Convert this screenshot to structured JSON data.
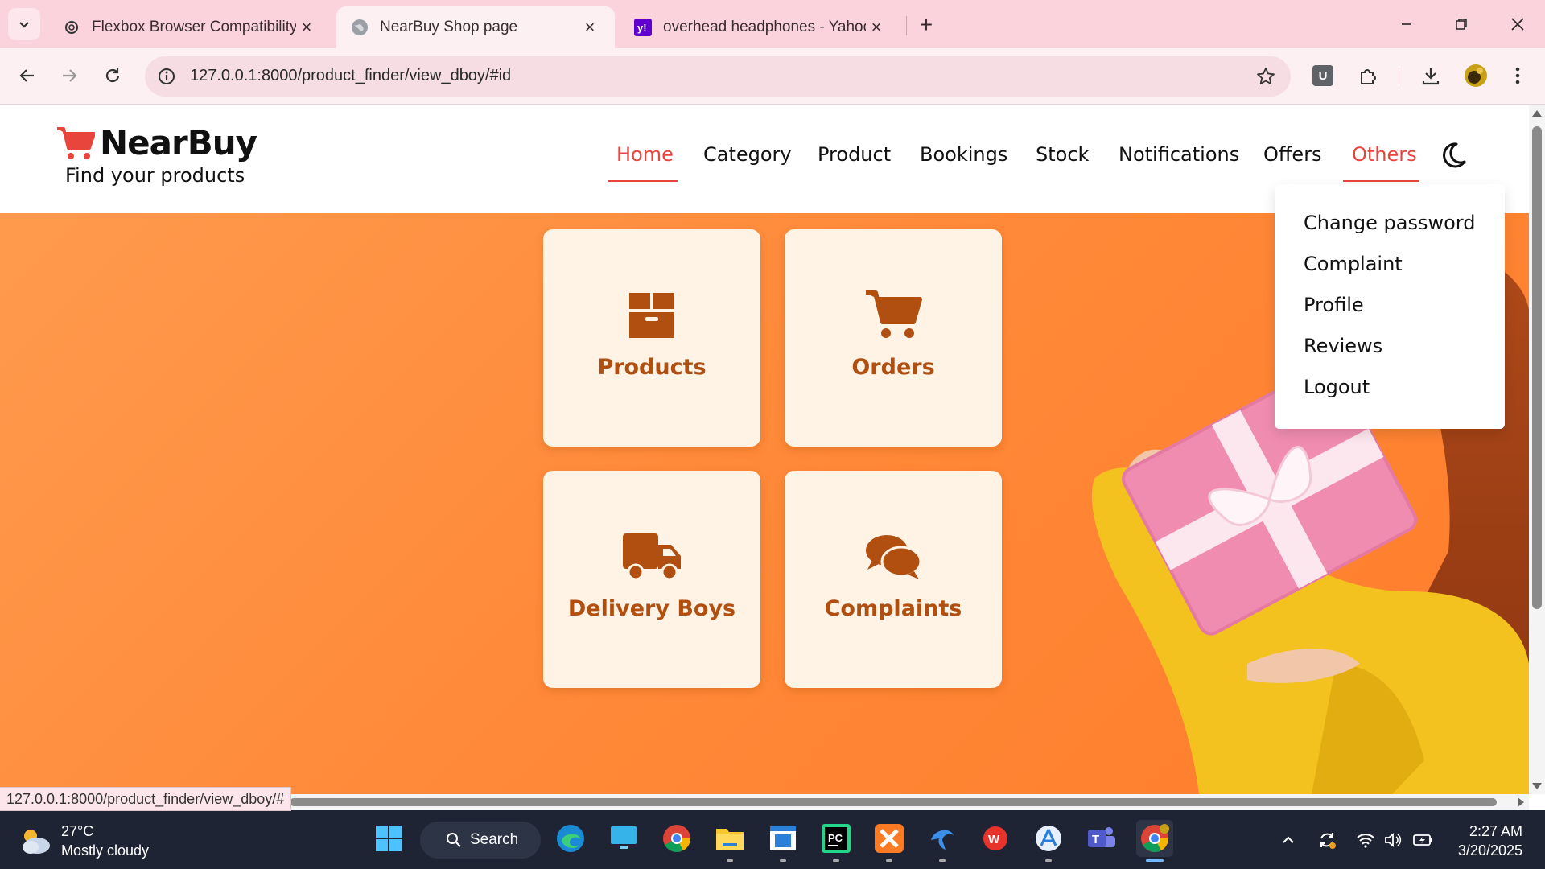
{
  "browser": {
    "tabs": [
      {
        "title": "Flexbox Browser Compatibility",
        "icon": "openai-icon",
        "active": false
      },
      {
        "title": "NearBuy Shop page",
        "icon": "globe-icon",
        "active": true
      },
      {
        "title": "overhead headphones - Yahoo",
        "icon": "yahoo-icon",
        "active": false
      }
    ],
    "url": "127.0.0.1:8000/product_finder/view_dboy/#id",
    "status_url": "127.0.0.1:8000/product_finder/view_dboy/#",
    "extension_badge": "U"
  },
  "site": {
    "brand_name": "NearBuy",
    "tagline": "Find your products",
    "nav": [
      "Home",
      "Category",
      "Product",
      "Bookings",
      "Stock",
      "Notifications",
      "Offers",
      "Others"
    ],
    "dropdown": [
      "Change password",
      "Complaint",
      "Profile",
      "Reviews",
      "Logout"
    ],
    "cards": [
      {
        "label": "Products",
        "icon": "box-icon"
      },
      {
        "label": "Orders",
        "icon": "cart-icon"
      },
      {
        "label": "Delivery Boys",
        "icon": "truck-icon"
      },
      {
        "label": "Complaints",
        "icon": "comments-icon"
      }
    ],
    "colors": {
      "accent": "#e8453c",
      "card_text": "#b14f10",
      "hero": "#ff8a3a",
      "card_bg": "#fff3e6"
    }
  },
  "taskbar": {
    "temperature": "27°C",
    "weather": "Mostly cloudy",
    "search": "Search",
    "time": "2:27 AM",
    "date": "3/20/2025"
  }
}
